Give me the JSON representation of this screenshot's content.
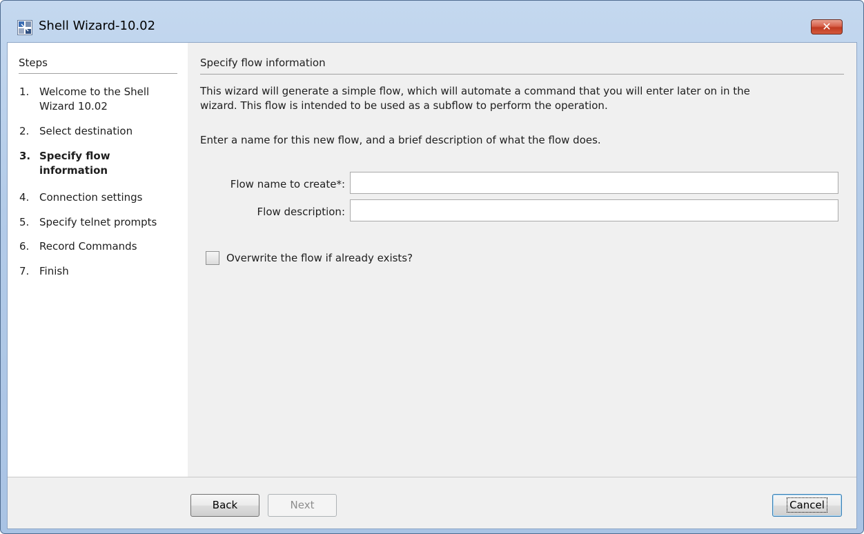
{
  "window": {
    "title": "Shell Wizard-10.02",
    "close_glyph": "✕"
  },
  "sidebar": {
    "header": "Steps",
    "steps": [
      {
        "num": "1.",
        "label": "Welcome to the Shell",
        "label2": "Wizard 10.02",
        "current": false
      },
      {
        "num": "2.",
        "label": "Select destination",
        "current": false
      },
      {
        "num": "3.",
        "label": "Specify flow",
        "label2": "information",
        "current": true
      },
      {
        "num": "4.",
        "label": "Connection settings",
        "current": false
      },
      {
        "num": "5.",
        "label": "Specify telnet prompts",
        "current": false
      },
      {
        "num": "6.",
        "label": "Record Commands",
        "current": false
      },
      {
        "num": "7.",
        "label": "Finish",
        "current": false
      }
    ]
  },
  "main": {
    "section_title": "Specify flow information",
    "intro_line1": "This wizard will generate a simple flow, which will automate a command that you will enter later on in the",
    "intro_line2": "wizard. This flow is intended to be used as a subflow to perform the operation.",
    "instruction": "Enter a name for this new flow, and a brief description of what the flow does.",
    "flow_name": {
      "label": "Flow name to create*:",
      "value": ""
    },
    "flow_description": {
      "label": "Flow description:",
      "value": ""
    },
    "overwrite": {
      "label": "Overwrite the flow if already exists?",
      "checked": false
    }
  },
  "footer": {
    "back_label": "Back",
    "next_label": "Next",
    "cancel_label": "Cancel"
  },
  "colors": {
    "titlebar": "#b3cbe8",
    "close_button": "#c9452c",
    "client_background": "#f0f0f0",
    "sidebar_background": "#ffffff"
  },
  "icons": {
    "app": "wizard-app-icon",
    "close": "close-icon"
  }
}
